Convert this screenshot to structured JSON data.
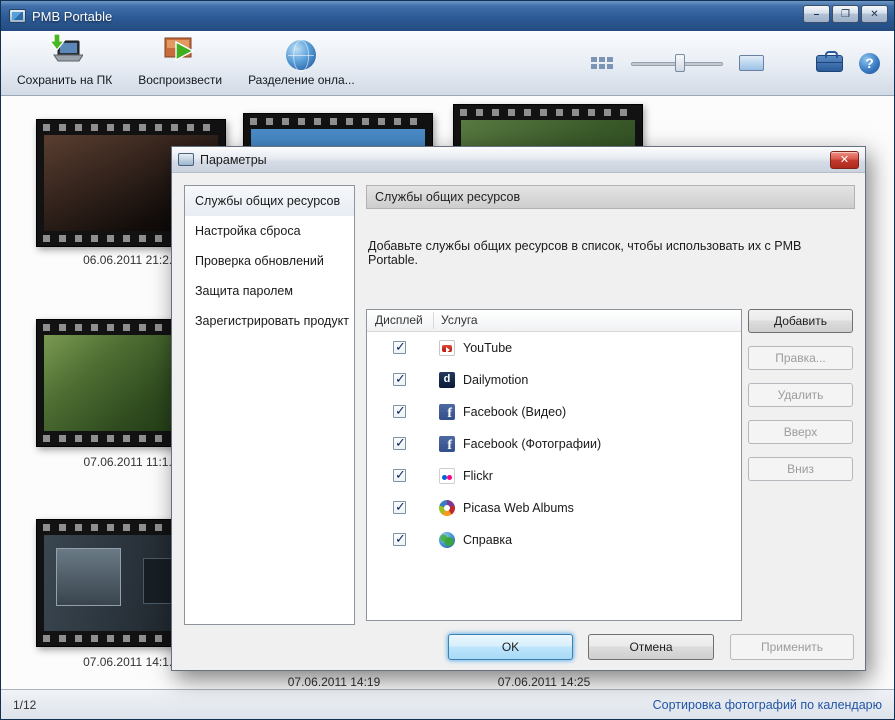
{
  "window": {
    "title": "PMB Portable",
    "controls": {
      "minimize": "–",
      "maximize": "❐",
      "close": "✕"
    }
  },
  "toolbar": {
    "buttons": [
      {
        "label": "Сохранить на ПК",
        "icon": "save-to-pc-icon"
      },
      {
        "label": "Воспроизвести",
        "icon": "play-photo-icon"
      },
      {
        "label": "Разделение онла...",
        "icon": "online-globe-icon"
      }
    ],
    "view_controls": {
      "grid_icon": "thumbnails-grid-icon",
      "slider": "zoom-slider",
      "single_icon": "single-image-icon"
    },
    "briefcase_icon": "briefcase-icon",
    "help_glyph": "?"
  },
  "thumbnails": [
    {
      "date": "06.06.2011 21:2..."
    },
    {
      "date": "07.06.2011 11:1..."
    },
    {
      "date": "07.06.2011 14:1..."
    }
  ],
  "bottom_dates": [
    "07.06.2011 14:19",
    "07.06.2011 14:25"
  ],
  "statusbar": {
    "counter": "1/12",
    "sort_link": "Сортировка фотографий по календарю"
  },
  "dialog": {
    "title": "Параметры",
    "close_glyph": "✕",
    "nav": [
      "Службы общих ресурсов",
      "Настройка сброса",
      "Проверка обновлений",
      "Защита паролем",
      "Зарегистрировать продукт"
    ],
    "section_header": "Службы общих ресурсов",
    "description": "Добавьте службы общих ресурсов в список, чтобы использовать их с PMB Portable.",
    "checkbox_glyph": "✓",
    "table": {
      "columns": [
        "Дисплей",
        "Услуга"
      ],
      "rows": [
        {
          "service": "YouTube",
          "icon": "youtube-icon",
          "checked": true
        },
        {
          "service": "Dailymotion",
          "icon": "dailymotion-icon",
          "checked": true
        },
        {
          "service": "Facebook (Видео)",
          "icon": "facebook-icon",
          "checked": true
        },
        {
          "service": "Facebook (Фотографии)",
          "icon": "facebook-icon",
          "checked": true
        },
        {
          "service": "Flickr",
          "icon": "flickr-icon",
          "checked": true
        },
        {
          "service": "Picasa Web Albums",
          "icon": "picasa-icon",
          "checked": true
        },
        {
          "service": "Справка",
          "icon": "help-globe-icon",
          "checked": true
        }
      ]
    },
    "side_buttons": [
      {
        "label": "Добавить",
        "enabled": true
      },
      {
        "label": "Правка...",
        "enabled": false
      },
      {
        "label": "Удалить",
        "enabled": false
      },
      {
        "label": "Вверх",
        "enabled": false
      },
      {
        "label": "Вниз",
        "enabled": false
      }
    ],
    "footer_buttons": [
      {
        "label": "OK",
        "enabled": true,
        "focused": true
      },
      {
        "label": "Отмена",
        "enabled": true,
        "focused": false
      },
      {
        "label": "Применить",
        "enabled": false,
        "focused": false
      }
    ]
  },
  "colors": {
    "titlebar_blue": "#2c5a96",
    "link_blue": "#2456a8",
    "dialog_close_red": "#c23b2e",
    "facebook_blue": "#3b5998",
    "youtube_red": "#cc181e"
  }
}
